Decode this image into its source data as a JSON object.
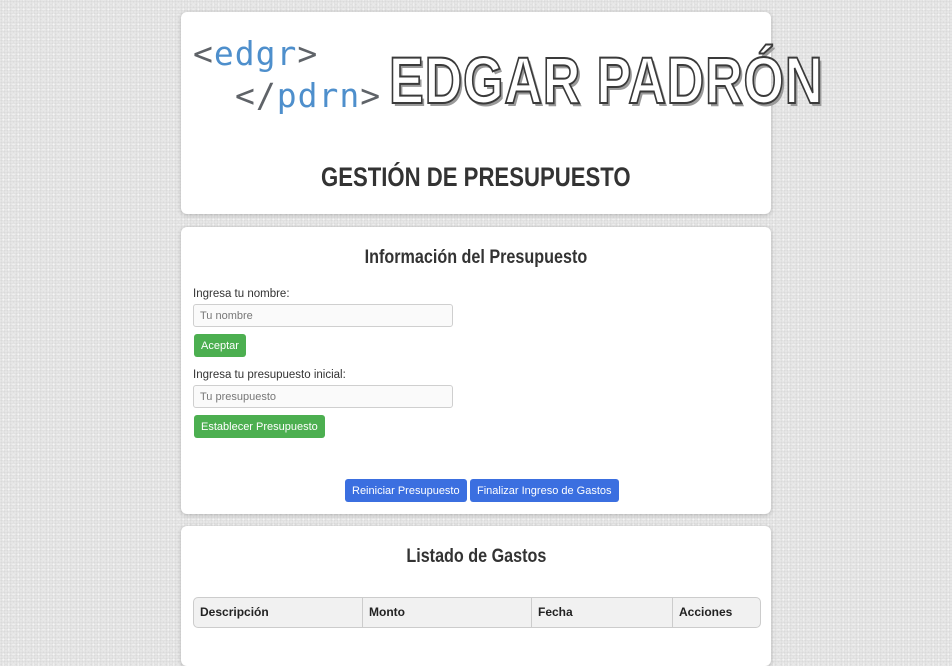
{
  "header": {
    "logo": {
      "line1_open": "<",
      "line1_word": "edgr",
      "line1_close": ">",
      "line2_open": "</",
      "line2_word": "pdrn",
      "line2_close": ">"
    },
    "brand_name": "EDGAR PADRÓN",
    "page_title": "GESTIÓN DE PRESUPUESTO"
  },
  "budget_form": {
    "title": "Información del Presupuesto",
    "name_label": "Ingresa tu nombre:",
    "name_placeholder": "Tu nombre",
    "name_value": "",
    "accept_button": "Aceptar",
    "budget_label": "Ingresa tu presupuesto inicial:",
    "budget_placeholder": "Tu presupuesto",
    "budget_value": "",
    "set_budget_button": "Establecer Presupuesto",
    "reset_button": "Reiniciar Presupuesto",
    "finish_button": "Finalizar Ingreso de Gastos"
  },
  "expense_list": {
    "title": "Listado de Gastos",
    "columns": [
      "Descripción",
      "Monto",
      "Fecha",
      "Acciones"
    ]
  },
  "colors": {
    "accent_green": "#4caf50",
    "accent_blue": "#3b6fe0",
    "logo_blue": "#4e8fcc"
  }
}
